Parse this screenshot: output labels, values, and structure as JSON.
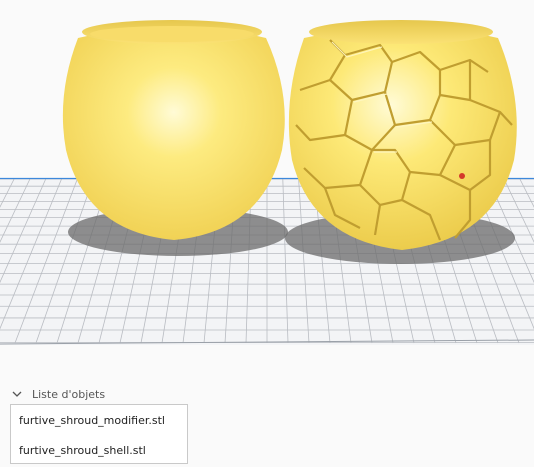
{
  "viewport": {
    "colors": {
      "background": "#fafafa",
      "build_plate": "#f3f4f6",
      "grid_line": "#b9bcc2",
      "plate_edge": "#3d88db",
      "model": "#fde76f",
      "model_highlight": "#fff9c8",
      "model_shadow": "#e8c850",
      "crack": "#c09e30"
    },
    "models": [
      {
        "name": "furtive_shroud_modifier.stl",
        "style": "solid"
      },
      {
        "name": "furtive_shroud_shell.stl",
        "style": "voronoi-cracked"
      }
    ]
  },
  "object_list": {
    "title": "Liste d'objets",
    "expanded": true,
    "items": [
      {
        "label": "furtive_shroud_modifier.stl"
      },
      {
        "label": "furtive_shroud_shell.stl"
      }
    ]
  }
}
